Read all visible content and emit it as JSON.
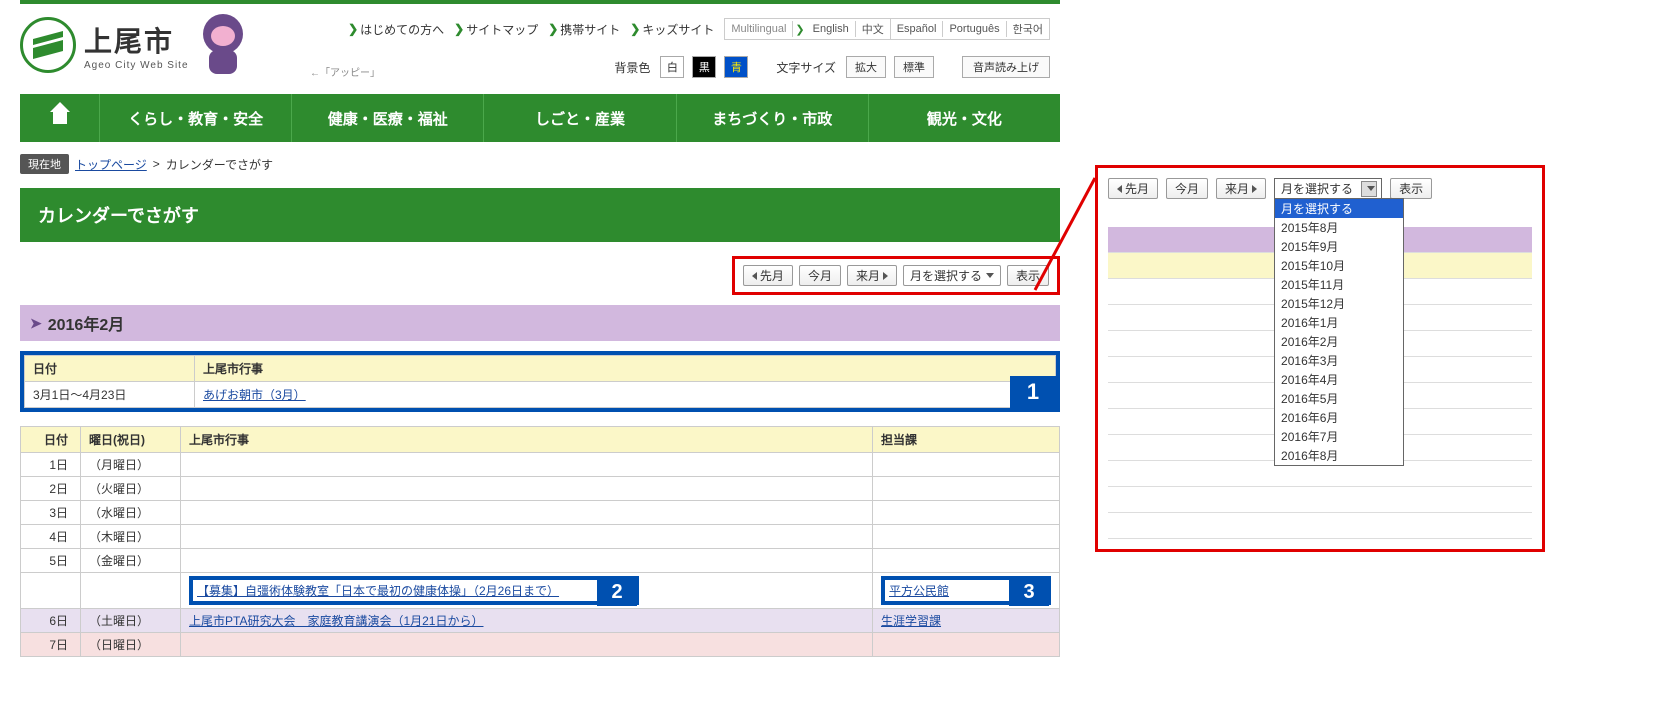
{
  "site": {
    "title": "上尾市",
    "subtitle": "Ageo City Web Site",
    "mascot_label": "←「アッピー」"
  },
  "topnav": {
    "items": [
      "はじめての方へ",
      "サイトマップ",
      "携帯サイト",
      "キッズサイト"
    ],
    "langs": [
      "Multilingual",
      "English",
      "中文",
      "Español",
      "Português",
      "한국어"
    ]
  },
  "settings": {
    "bg_label": "背景色",
    "bg_white": "白",
    "bg_black": "黒",
    "bg_blue": "青",
    "size_label": "文字サイズ",
    "size_large": "拡大",
    "size_std": "標準",
    "voice": "音声読み上げ"
  },
  "gnav": [
    "くらし・教育・安全",
    "健康・医療・福祉",
    "しごと・産業",
    "まちづくり・市政",
    "観光・文化"
  ],
  "breadcrumb": {
    "badge": "現在地",
    "home": "トップページ",
    "current": "カレンダーでさがす"
  },
  "page_title": "カレンダーでさがす",
  "monthnav": {
    "prev": "先月",
    "today": "今月",
    "next": "来月",
    "select_placeholder": "月を選択する",
    "show": "表示"
  },
  "month_heading": "2016年2月",
  "summary_table": {
    "headers": [
      "日付",
      "上尾市行事"
    ],
    "rows": [
      {
        "date": "3月1日～4月23日",
        "event": "あげお朝市（3月）"
      }
    ],
    "badge": "1"
  },
  "calendar_table": {
    "headers": [
      "日付",
      "曜日(祝日)",
      "上尾市行事",
      "担当課"
    ],
    "rows": [
      {
        "date": "1日",
        "day": "（月曜日）",
        "event": "",
        "dept": ""
      },
      {
        "date": "2日",
        "day": "（火曜日）",
        "event": "",
        "dept": ""
      },
      {
        "date": "3日",
        "day": "（水曜日）",
        "event": "",
        "dept": ""
      },
      {
        "date": "4日",
        "day": "（木曜日）",
        "event": "",
        "dept": ""
      },
      {
        "date": "5日",
        "day": "（金曜日）",
        "event": "",
        "dept": ""
      },
      {
        "date": "",
        "day": "",
        "event": "【募集】自彊術体験教室「日本で最初の健康体操」（2月26日まで）",
        "dept": "平方公民館",
        "hl": true
      },
      {
        "date": "6日",
        "day": "（土曜日）",
        "event": "上尾市PTA研究大会　家庭教育講演会（1月21日から）",
        "dept": "生涯学習課",
        "cls": "sat"
      },
      {
        "date": "7日",
        "day": "（日曜日）",
        "event": "",
        "dept": "",
        "cls": "sun"
      }
    ],
    "badge2": "2",
    "badge3": "3"
  },
  "dropdown_options": [
    "月を選択する",
    "2015年8月",
    "2015年9月",
    "2015年10月",
    "2015年11月",
    "2015年12月",
    "2016年1月",
    "2016年2月",
    "2016年3月",
    "2016年4月",
    "2016年5月",
    "2016年6月",
    "2016年7月",
    "2016年8月"
  ]
}
